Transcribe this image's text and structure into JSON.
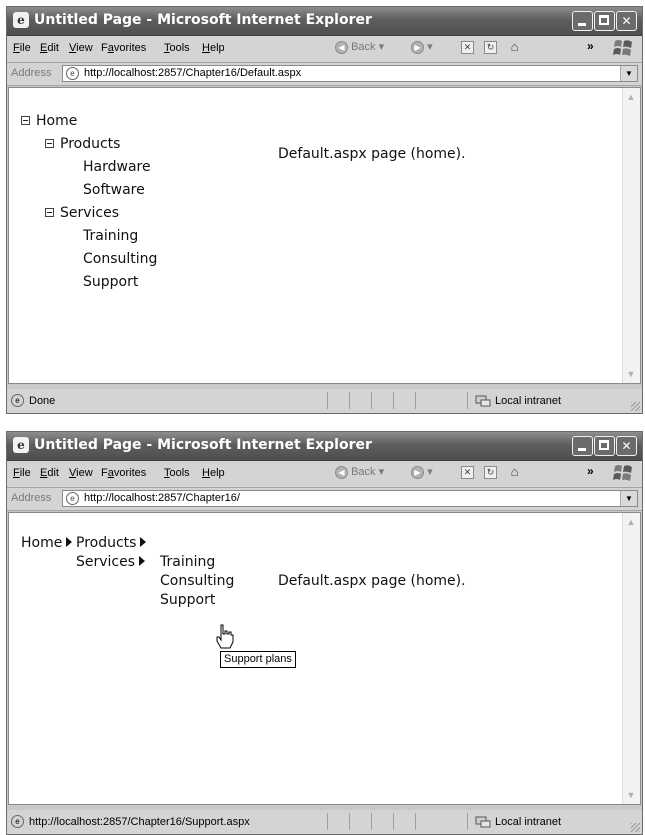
{
  "menu": [
    "File",
    "Edit",
    "View",
    "Favorites",
    "Tools",
    "Help"
  ],
  "menu_mnemonics": [
    "F",
    "E",
    "V",
    "a",
    "T",
    "H"
  ],
  "toolbar": {
    "back_label": "Back",
    "chevron": "»"
  },
  "address_label": "Address",
  "window1": {
    "title": "Untitled Page - Microsoft Internet Explorer",
    "address_url": "http://localhost:2857/Chapter16/Default.aspx",
    "treeview": {
      "home": "Home",
      "products": "Products",
      "hardware": "Hardware",
      "software": "Software",
      "services": "Services",
      "training": "Training",
      "consulting": "Consulting",
      "support": "Support"
    },
    "page_text": "Default.aspx page (home).",
    "status_text": "Done",
    "zone": "Local intranet"
  },
  "window2": {
    "title": "Untitled Page - Microsoft Internet Explorer",
    "address_url": "http://localhost:2857/Chapter16/",
    "menu_control": {
      "home": "Home",
      "products": "Products",
      "services": "Services",
      "training": "Training",
      "consulting": "Consulting",
      "support": "Support"
    },
    "page_text": "Default.aspx page (home).",
    "tooltip": "Support plans",
    "status_text": "http://localhost:2857/Chapter16/Support.aspx",
    "zone": "Local intranet"
  }
}
